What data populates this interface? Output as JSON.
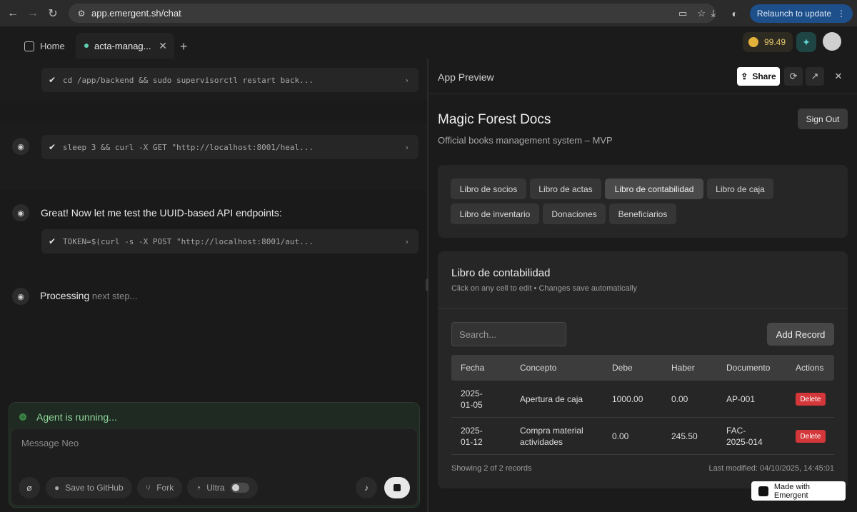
{
  "browser": {
    "url": "app.emergent.sh/chat",
    "relaunch_label": "Relaunch to update",
    "tabs": [
      {
        "label": "Home"
      },
      {
        "label": "acta-manag..."
      }
    ],
    "credits": "99.49"
  },
  "chat": {
    "commands": [
      {
        "text": "cd /app/backend && sudo supervisorctl restart back..."
      },
      {
        "text": "sleep 3 && curl -X GET \"http://localhost:8001/heal..."
      },
      {
        "text": "TOKEN=$(curl -s -X POST \"http://localhost:8001/aut..."
      }
    ],
    "message": "Great! Now let me test the UUID-based API endpoints:",
    "processing_main": "Processing",
    "processing_rest": " next step...",
    "status": "Agent is running...",
    "composer_placeholder": "Message Neo",
    "actions": {
      "save_github": "Save to GitHub",
      "fork": "Fork",
      "ultra": "Ultra"
    }
  },
  "preview": {
    "title": "App Preview",
    "share_label": "Share",
    "app": {
      "title": "Magic Forest Docs",
      "subtitle": "Official books management system – MVP",
      "signout_label": "Sign Out"
    },
    "book_tabs": [
      {
        "label": "Libro de socios"
      },
      {
        "label": "Libro de actas"
      },
      {
        "label": "Libro de contabilidad"
      },
      {
        "label": "Libro de caja"
      },
      {
        "label": "Libro de inventario"
      },
      {
        "label": "Donaciones"
      },
      {
        "label": "Beneficiarios"
      }
    ],
    "table": {
      "title": "Libro de contabilidad",
      "subtitle": "Click on any cell to edit • Changes save automatically",
      "search_placeholder": "Search...",
      "add_label": "Add Record",
      "headers": [
        "Fecha",
        "Concepto",
        "Debe",
        "Haber",
        "Documento",
        "Actions"
      ],
      "rows": [
        {
          "fecha_1": "2025-",
          "fecha_2": "01-05",
          "concepto_1": "Apertura de caja",
          "concepto_2": "",
          "debe": "1000.00",
          "haber": "0.00",
          "doc_1": "AP-001",
          "doc_2": "",
          "action": "Delete"
        },
        {
          "fecha_1": "2025-",
          "fecha_2": "01-12",
          "concepto_1": "Compra material",
          "concepto_2": "actividades",
          "debe": "0.00",
          "haber": "245.50",
          "doc_1": "FAC-",
          "doc_2": "2025-014",
          "action": "Delete"
        }
      ],
      "footer_left": "Showing 2 of 2 records",
      "footer_right": "Last modified: 04/10/2025, 14:45:01"
    },
    "made_with": "Made with Emergent"
  }
}
